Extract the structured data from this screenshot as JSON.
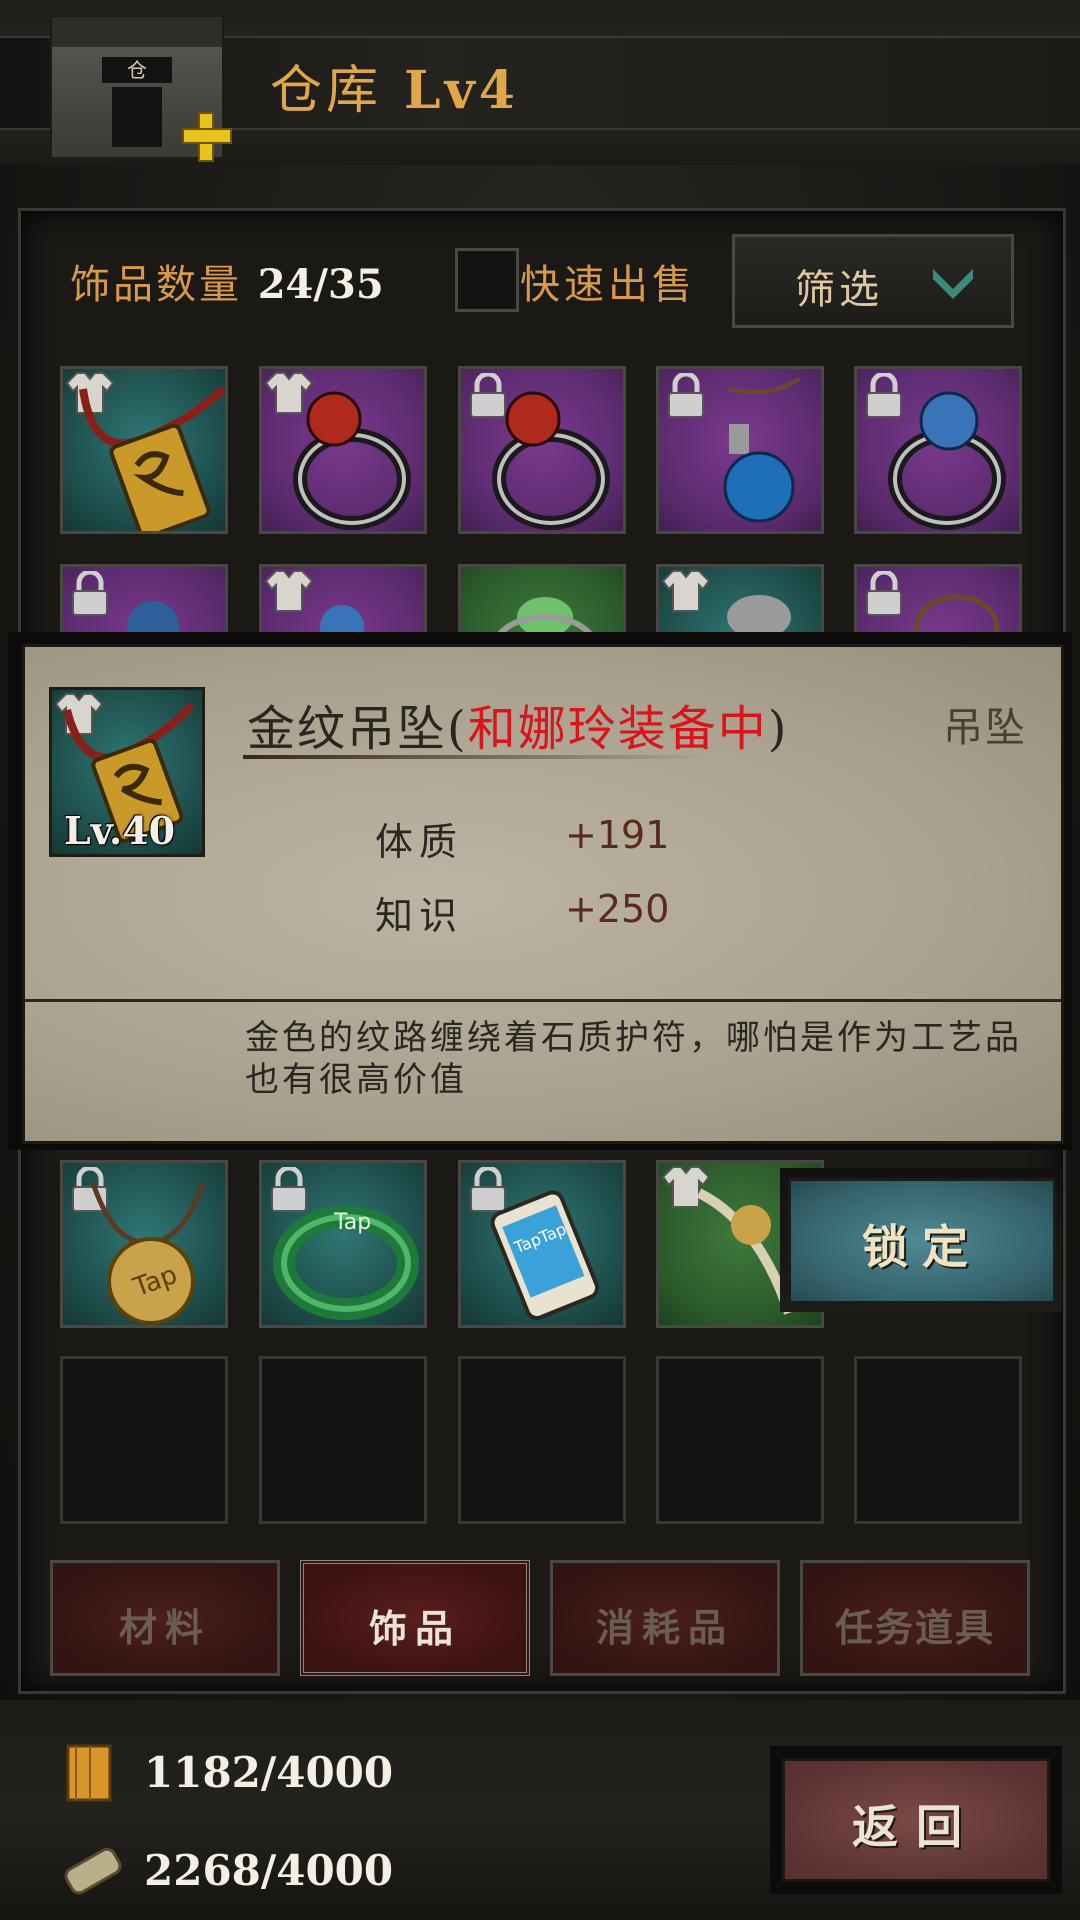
{
  "header": {
    "title": "仓库",
    "level": "Lv4",
    "building_sign": "仓"
  },
  "toolbar": {
    "count_label": "饰品数量",
    "count_value": "24/35",
    "quick_sell_label": "快速出售",
    "quick_sell_checked": false,
    "filter_label": "筛选"
  },
  "grid": {
    "rows": [
      [
        {
          "rarity": "teal",
          "badge": "shirt",
          "item": "gold-pendant"
        },
        {
          "rarity": "purple",
          "badge": "shirt",
          "item": "red-gem-ring"
        },
        {
          "rarity": "purple",
          "badge": "lock",
          "item": "red-gem-ring"
        },
        {
          "rarity": "purple",
          "badge": "lock",
          "item": "blue-gem-pendant"
        },
        {
          "rarity": "purple",
          "badge": "lock",
          "item": "blue-gem-ring"
        }
      ],
      [
        {
          "rarity": "purple",
          "badge": "lock",
          "item": "blue-gem-ring"
        },
        {
          "rarity": "purple",
          "badge": "shirt",
          "item": "blue-gem-ring"
        },
        {
          "rarity": "green",
          "badge": "none",
          "item": "green-gem-ring"
        },
        {
          "rarity": "teal",
          "badge": "shirt",
          "item": "silver-amulet"
        },
        {
          "rarity": "purple",
          "badge": "lock",
          "item": "necklace"
        }
      ],
      [
        {
          "rarity": "teal",
          "badge": "lock",
          "item": "tap-coin-pendant"
        },
        {
          "rarity": "teal",
          "badge": "lock",
          "item": "jade-tap-ring"
        },
        {
          "rarity": "teal",
          "badge": "lock",
          "item": "taptap-phone"
        },
        {
          "rarity": "green",
          "badge": "shirt",
          "item": "cord-amulet"
        },
        {
          "rarity": "teal",
          "badge": "none",
          "item": "hidden"
        }
      ]
    ],
    "jade_ring_text": "Tap",
    "phone_text": "TapTap",
    "coin_text": "Tap"
  },
  "tooltip": {
    "item_name": "金纹吊坠",
    "paren_open": "(",
    "equipped_text": "和娜玲装备中",
    "paren_close": ")",
    "item_type": "吊坠",
    "level": "Lv.40",
    "stats": [
      {
        "name": "体质",
        "value": "+191"
      },
      {
        "name": "知识",
        "value": "+250"
      }
    ],
    "description": "金色的纹路缠绕着石质护符，哪怕是作为工艺品也有很高价值"
  },
  "lock_button": {
    "label": "锁定"
  },
  "tabs": [
    {
      "label": "材料",
      "active": false
    },
    {
      "label": "饰品",
      "active": true
    },
    {
      "label": "消耗品",
      "active": false
    },
    {
      "label": "任务道具",
      "active": false
    }
  ],
  "resources": [
    {
      "icon": "scroll-icon",
      "value": "1182/4000"
    },
    {
      "icon": "parchment-icon",
      "value": "2268/4000"
    }
  ],
  "back_button": {
    "label": "返回"
  },
  "colors": {
    "accent_orange": "#d89a4a",
    "equipped_red": "#d9141a",
    "rarity_teal": "#2f7774",
    "rarity_purple": "#7a3a8e",
    "rarity_green": "#3e7a3c"
  }
}
